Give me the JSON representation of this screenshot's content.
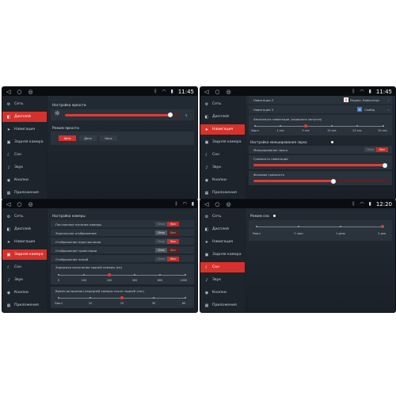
{
  "menu": [
    "Сеть",
    "Дисплей",
    "Навигация",
    "Задняя камера",
    "Сон",
    "Звук",
    "Кнопки",
    "Приложения"
  ],
  "menu_icons": [
    "gear-icon",
    "display-icon",
    "navigation-icon",
    "camera-icon",
    "sleep-icon",
    "sound-icon",
    "buttons-icon",
    "apps-icon"
  ],
  "panel1": {
    "clock": "11:45",
    "brightness_title": "Настройка яркости",
    "brightness_value": "5",
    "brightness_level": 0.92,
    "mode_title": "Режим яркости",
    "modes": [
      "Авто",
      "День",
      "Ночь"
    ],
    "selected_mode": 0
  },
  "panel2": {
    "clock": "11:45",
    "nav2_label": "Навигация 2",
    "nav2_app": "Яндекс Навигатор",
    "nav3_label": "Навигация 3",
    "nav3_app": "Сообщ",
    "autostart_title": "Автозапуск навигации (задержка запуска)",
    "autostart_ticks": [
      "Выкл",
      "1 сек",
      "5 сек",
      "15 сек",
      "20 сек",
      "30 сек"
    ],
    "autostart_selected": 2,
    "mix_title": "Настройка микширования звука",
    "mix_row": "Микширование звука",
    "mix_off": "Откл",
    "mix_on": "Вкл",
    "nav_volume_label": "Громкость навигации",
    "nav_volume_level": 0.98,
    "bg_volume_label": "Фоновая громкость",
    "bg_volume_level": 0.6
  },
  "panel3": {
    "title": "Настройка камеры",
    "rows": [
      {
        "label": "Постоянное питание камеры",
        "off": "Откл",
        "on": "Вкл",
        "state": "on"
      },
      {
        "label": "Зеркальное отображение",
        "off": "Откл",
        "on": "Вкл",
        "state": "off"
      },
      {
        "label": "Отображение парктроников",
        "off": "Откл",
        "on": "Вкл",
        "state": "on"
      },
      {
        "label": "Отображение траектории",
        "off": "Откл",
        "on": "Вкл",
        "state": "off"
      },
      {
        "label": "Отображение линий",
        "off": "Откл",
        "on": "Вкл",
        "state": "on"
      }
    ],
    "rear_delay_title": "Задержка включения задней камеры (мс)",
    "rear_delay_ticks": [
      "0",
      "100",
      "200",
      "300",
      "600",
      "1000"
    ],
    "rear_delay_selected": 2,
    "front_time_title": "Время включения передней камеры после задней (сек)",
    "front_time_ticks": [
      "Выкл",
      "10",
      "15",
      "30",
      "60"
    ],
    "front_time_selected": 2
  },
  "panel4": {
    "clock": "12:20",
    "sleep_title": "Режим сна",
    "sleep_ticks": [
      "Выкл",
      "2 часа",
      "1 день",
      "3 дня"
    ],
    "sleep_selected": 3
  },
  "colors": {
    "accent": "#d6312b",
    "panel_bg": "#1a2129",
    "sidebar_bg": "#1d242c"
  }
}
